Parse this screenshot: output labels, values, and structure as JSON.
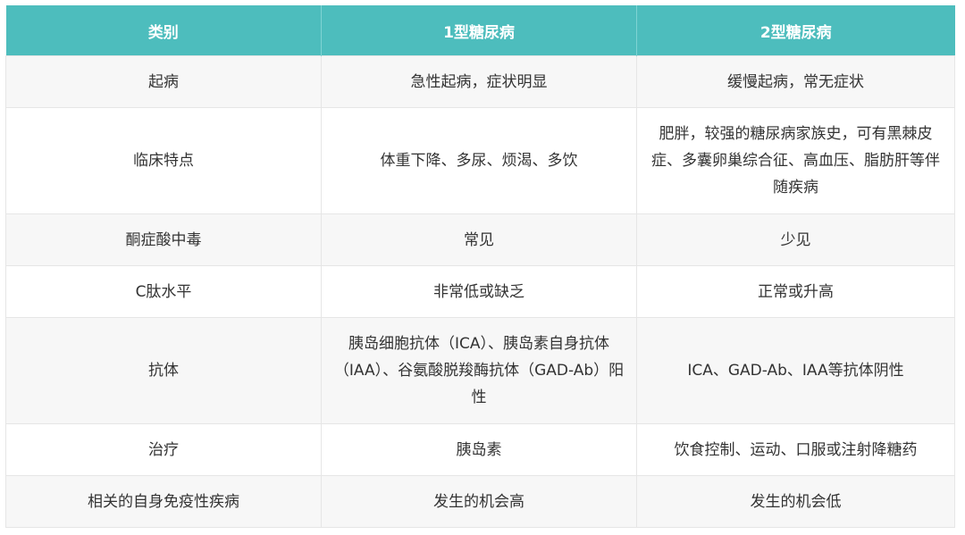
{
  "table": {
    "headers": [
      "类别",
      "1型糖尿病",
      "2型糖尿病"
    ],
    "rows": [
      [
        "起病",
        "急性起病，症状明显",
        "缓慢起病，常无症状"
      ],
      [
        "临床特点",
        "体重下降、多尿、烦渴、多饮",
        "肥胖，较强的糖尿病家族史，可有黑棘皮症、多囊卵巢综合征、高血压、脂肪肝等伴随疾病"
      ],
      [
        "酮症酸中毒",
        "常见",
        "少见"
      ],
      [
        "C肽水平",
        "非常低或缺乏",
        "正常或升高"
      ],
      [
        "抗体",
        "胰岛细胞抗体（ICA）、胰岛素自身抗体（IAA）、谷氨酸脱羧酶抗体（GAD-Ab）阳性",
        "ICA、GAD-Ab、IAA等抗体阴性"
      ],
      [
        "治疗",
        "胰岛素",
        "饮食控制、运动、口服或注射降糖药"
      ],
      [
        "相关的自身免疫性疾病",
        "发生的机会高",
        "发生的机会低"
      ]
    ]
  },
  "colors": {
    "header_bg": "#4dbdbd",
    "header_text": "#ffffff",
    "row_alt_bg": "#f7f7f7",
    "border": "#e6e6e6"
  }
}
